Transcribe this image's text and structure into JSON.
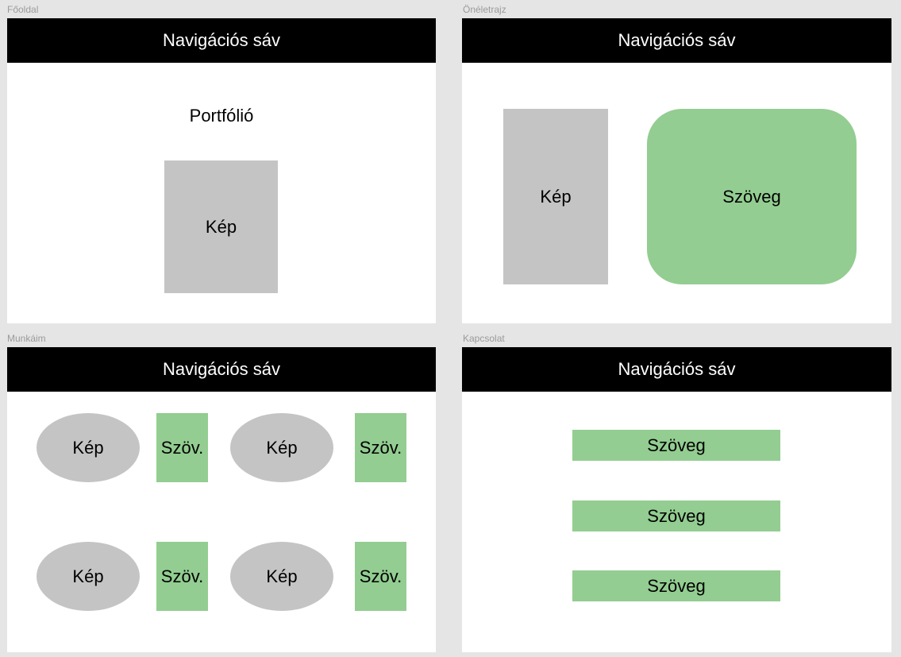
{
  "colors": {
    "canvas": "#e5e5e5",
    "frame": "#ffffff",
    "nav": "#000000",
    "placeholder_grey": "#c4c4c4",
    "placeholder_green": "#93cd91"
  },
  "frames": {
    "fooldal": {
      "label": "Főoldal",
      "nav": "Navigációs sáv",
      "title": "Portfólió",
      "image": "Kép"
    },
    "oneletrajz": {
      "label": "Önéletrajz",
      "nav": "Navigációs sáv",
      "image": "Kép",
      "text": "Szöveg"
    },
    "munkaim": {
      "label": "Munkáim",
      "nav": "Navigációs sáv",
      "items": [
        {
          "image": "Kép",
          "text": "Szöv."
        },
        {
          "image": "Kép",
          "text": "Szöv."
        },
        {
          "image": "Kép",
          "text": "Szöv."
        },
        {
          "image": "Kép",
          "text": "Szöv."
        }
      ]
    },
    "kapcsolat": {
      "label": "Kapcsolat",
      "nav": "Navigációs sáv",
      "texts": [
        "Szöveg",
        "Szöveg",
        "Szöveg"
      ]
    }
  }
}
